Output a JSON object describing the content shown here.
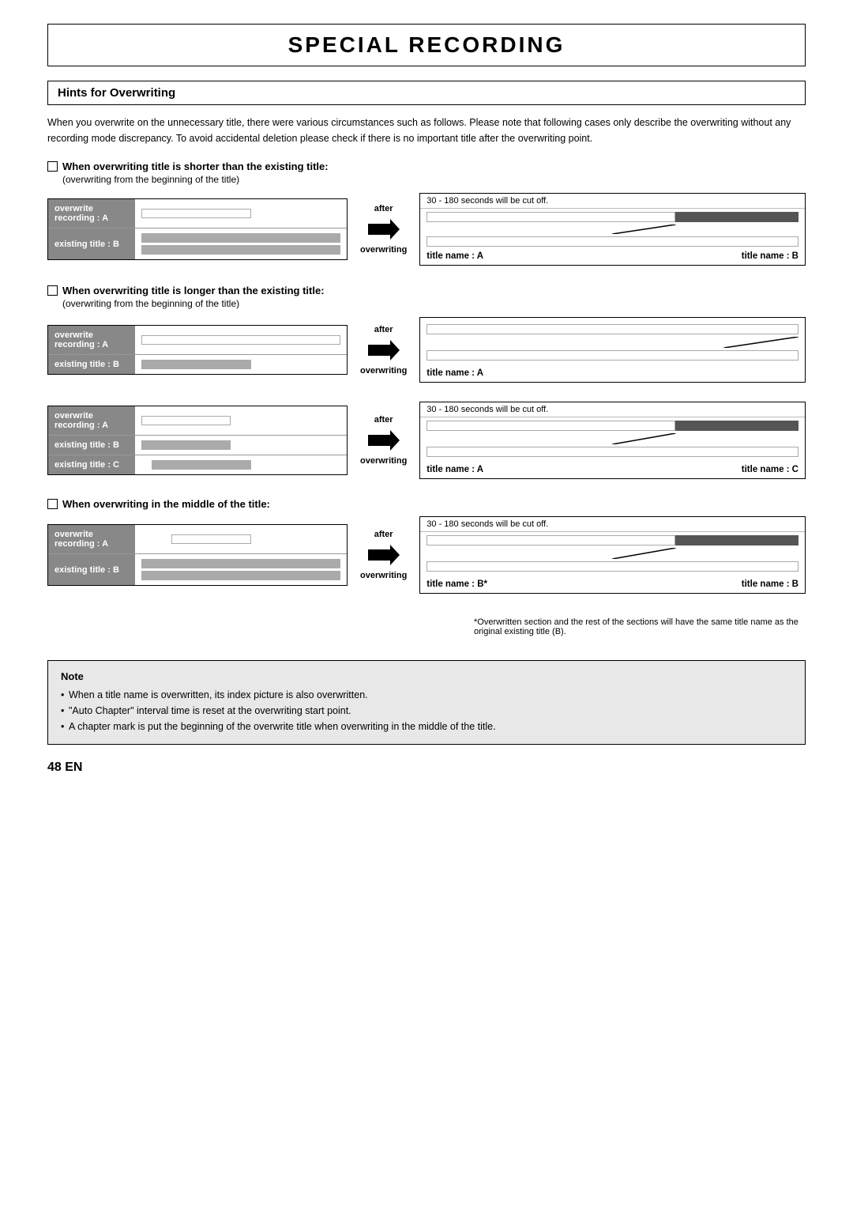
{
  "page": {
    "title": "SPECIAL RECORDING",
    "section": "Hints for Overwriting",
    "intro": "When you overwrite on the unnecessary title, there were various circumstances such as follows.  Please note that following cases only describe the overwriting without any recording mode discrepancy.  To avoid accidental deletion please check if there is no important title after the overwriting point.",
    "page_number": "48  EN"
  },
  "scenarios": [
    {
      "id": "scenario1",
      "title": "When overwriting title is shorter than the existing title:",
      "subtitle": "(overwriting from the beginning of the title)",
      "left_rows": [
        {
          "label": "overwrite\nrecording : A",
          "bars": [
            "white_half"
          ]
        },
        {
          "label": "existing title : B",
          "bars": [
            "gray_full",
            "gray_full"
          ]
        }
      ],
      "right_note": "30 - 180 seconds will be cut off.",
      "right_bars": [
        {
          "type": "split",
          "left": "white",
          "right": "dark"
        },
        {
          "type": "single",
          "color": "white",
          "extra_line": true
        }
      ],
      "right_labels": [
        "title name : A",
        "title name : B"
      ],
      "arrow_label": "after\noverwriting"
    },
    {
      "id": "scenario2",
      "title": "When overwriting title is longer than the existing title:",
      "subtitle": "(overwriting from the beginning of the title)",
      "left_rows": [
        {
          "label": "overwrite\nrecording : A",
          "bars": [
            "white_full"
          ]
        },
        {
          "label": "existing title : B",
          "bars": [
            "gray_half"
          ]
        }
      ],
      "right_note": null,
      "right_bars": [
        {
          "type": "single",
          "color": "white"
        },
        {
          "type": "diagonal_line"
        }
      ],
      "right_labels": [
        "title name : A"
      ],
      "arrow_label": "after\noverwriting"
    },
    {
      "id": "scenario3",
      "title": null,
      "subtitle": null,
      "left_rows": [
        {
          "label": "overwrite\nrecording : A",
          "bars": [
            "white_half2"
          ]
        },
        {
          "label": "existing title : B",
          "bars": [
            "gray_half"
          ]
        },
        {
          "label": "existing title : C",
          "bars": [
            "gray_half2"
          ]
        }
      ],
      "right_note": "30 - 180 seconds will be cut off.",
      "right_bars": [
        {
          "type": "split",
          "left": "white",
          "right": "dark"
        },
        {
          "type": "diagonal_line2"
        }
      ],
      "right_labels": [
        "title name : A",
        "title name : C"
      ],
      "arrow_label": "after\noverwriting"
    },
    {
      "id": "scenario4",
      "title": "When overwriting in the middle of the title:",
      "subtitle": null,
      "left_rows": [
        {
          "label": "overwrite\nrecording : A",
          "bars": [
            "white_mid"
          ]
        },
        {
          "label": "existing title : B",
          "bars": [
            "gray_full",
            "gray_full"
          ]
        }
      ],
      "right_note": "30 - 180 seconds will be cut off.",
      "right_bars": [
        {
          "type": "split",
          "left": "white",
          "right": "dark"
        },
        {
          "type": "diagonal_line3"
        }
      ],
      "right_labels": [
        "title name : B*",
        "title name : B"
      ],
      "arrow_label": "after\noverwriting"
    }
  ],
  "footnote": "*Overwritten section and the rest of the sections will have the same title name as the original existing title (B).",
  "note_box": {
    "title": "Note",
    "items": [
      "When a title name is overwritten, its index picture is also overwritten.",
      "\"Auto Chapter\" interval time is reset at the overwriting start point.",
      "A chapter mark is put the beginning of the overwrite title when overwriting in the middle of the title."
    ]
  }
}
